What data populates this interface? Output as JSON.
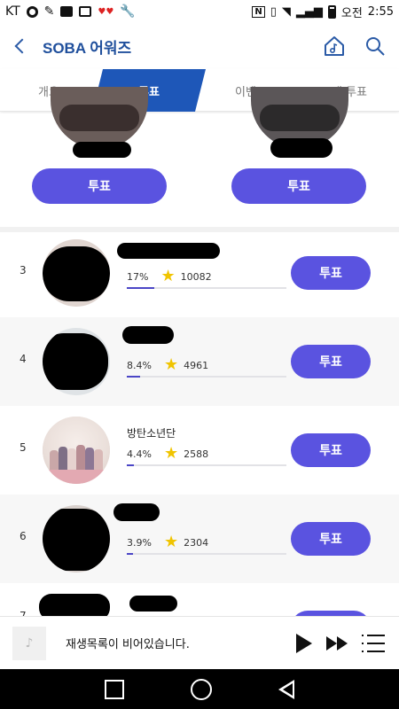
{
  "status_bar": {
    "carrier": "KT",
    "nfc_label": "N",
    "ampm": "오전",
    "time": "2:55"
  },
  "header": {
    "title": "SOBA 어워즈",
    "back_icon": "chevron-left-icon",
    "home_icon": "music-home-icon",
    "search_icon": "search-icon",
    "accent_color": "#1f4f9c"
  },
  "tabs": [
    {
      "label": "개요",
      "active": false
    },
    {
      "label": "투표",
      "active": true
    },
    {
      "label": "이벤트",
      "active": false
    },
    {
      "label": "내 투표",
      "active": false
    }
  ],
  "top_cards": [
    {
      "vote_label": "투표"
    },
    {
      "vote_label": "투표"
    }
  ],
  "rankings": [
    {
      "rank": "3",
      "name": "",
      "percent": "17%",
      "percent_value": 17,
      "votes": "10082",
      "vote_label": "투표"
    },
    {
      "rank": "4",
      "name": "",
      "percent": "8.4%",
      "percent_value": 8.4,
      "votes": "4961",
      "vote_label": "투표"
    },
    {
      "rank": "5",
      "name": "방탄소년단",
      "percent": "4.4%",
      "percent_value": 4.4,
      "votes": "2588",
      "vote_label": "투표"
    },
    {
      "rank": "6",
      "name": "",
      "percent": "3.9%",
      "percent_value": 3.9,
      "votes": "2304",
      "vote_label": "투표"
    },
    {
      "rank": "7",
      "name": "",
      "percent": "",
      "votes": "",
      "vote_label": "투표"
    }
  ],
  "player": {
    "empty_text": "재생목록이 비어있습니다.",
    "note_glyph": "♪",
    "play_icon": "play-icon",
    "next_icon": "fast-forward-icon",
    "playlist_icon": "playlist-icon"
  },
  "colors": {
    "vote_button": "#5a53e0",
    "active_tab": "#1e57b8",
    "star": "#f0c400",
    "progress_fill": "#4b46c6"
  }
}
